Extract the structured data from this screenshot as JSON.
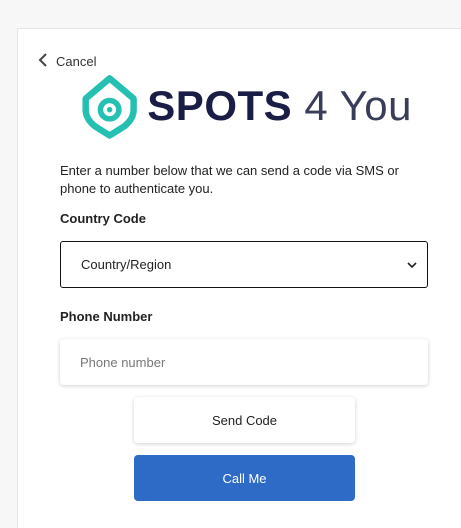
{
  "nav": {
    "cancel_label": "Cancel"
  },
  "logo": {
    "strong": "SPOTS",
    "light": "4 You",
    "mark_color": "#26c0b3"
  },
  "intro_text": "Enter a number below that we can send a code via SMS or phone to authenticate you.",
  "country": {
    "label": "Country Code",
    "selected": "Country/Region"
  },
  "phone": {
    "label": "Phone Number",
    "placeholder": "Phone number",
    "value": ""
  },
  "buttons": {
    "send_code": "Send Code",
    "call_me": "Call Me",
    "call_me_color": "#2e6bc6"
  }
}
